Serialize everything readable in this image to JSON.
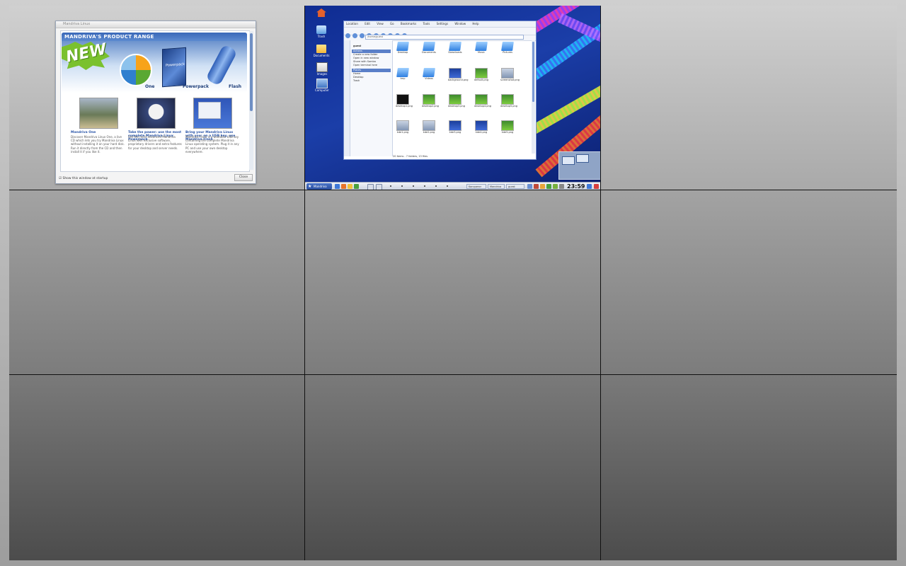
{
  "mandriva_window": {
    "title": "Mandriva Linux",
    "banner_heading": "MANDRIVA'S PRODUCT RANGE",
    "new_badge": "NEW",
    "products": [
      "One",
      "Powerpack",
      "Flash"
    ],
    "dvd_label": "Powerpack",
    "columns": [
      {
        "title": "Mandriva One",
        "text": "Discover Mandriva Linux One, a live CD which lets you try Mandriva Linux without installing it on your hard disk. Run it directly from the CD and then install it if you like it."
      },
      {
        "title": "Take the power: use the most complete Mandriva Linux Powerpack",
        "text": "Get the most advanced Mandriva Linux with exclusive software, proprietary drivers and extra features for your desktop and server needs."
      },
      {
        "title": "Bring your Mandriva Linux with you: on a USB key, use Mandriva Flash",
        "text": "Mandriva Flash is a bootable USB key containing the complete Mandriva Linux operating system. Plug it in any PC and use your own desktop everywhere."
      }
    ],
    "footer_checkbox": "Show this window at startup",
    "close_button": "Close"
  },
  "desktop": {
    "icons": [
      "Home",
      "Trash",
      "Documents",
      "Images",
      "Computer"
    ],
    "file_manager": {
      "menu": [
        "Location",
        "Edit",
        "View",
        "Go",
        "Bookmarks",
        "Tools",
        "Settings",
        "Window",
        "Help"
      ],
      "location": "/home/guest",
      "panel_user": "guest",
      "panel_sections": [
        "Actions",
        "Places"
      ],
      "panel_items": [
        "Create a new folder",
        "Open in new window",
        "Share with Samba",
        "Open terminal here",
        "Home",
        "Desktop",
        "Trash"
      ],
      "files": [
        "Desktop",
        "Documents",
        "Downloads",
        "Music",
        "Pictures",
        "tmp",
        "Videos",
        "background.png",
        "default.png",
        "screenshot.png",
        "desktop1.png",
        "desktop2.png",
        "desktop3.png",
        "desktop4.png",
        "desktop5.png",
        "kde1.png",
        "kde2.png",
        "kde3.png",
        "kde4.png",
        "kde5.png"
      ],
      "status": "20 items - 7 folders, 13 files"
    },
    "taskbar": {
      "start_label": "Mandriva",
      "tasks": [
        "Konqueror",
        "Mandriva Linux",
        "guest"
      ],
      "clock": "23:59"
    }
  }
}
